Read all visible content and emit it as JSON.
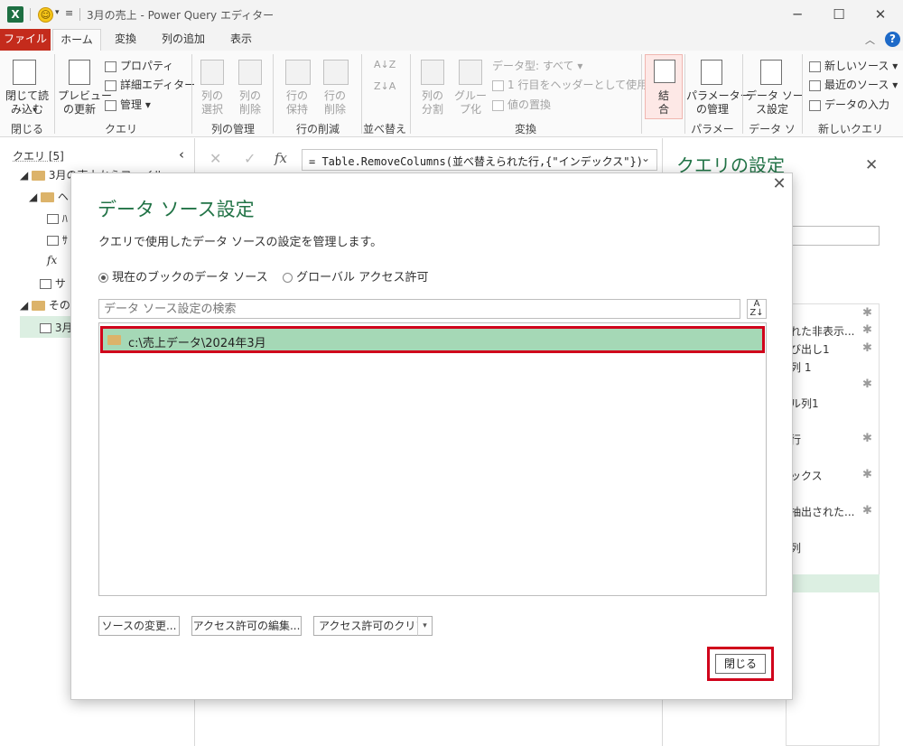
{
  "titlebar": {
    "title": "3月の売上 - Power Query エディター",
    "minimize": "─",
    "maximize": "☐",
    "close": "✕"
  },
  "tabs": [
    {
      "label": "ファイル"
    },
    {
      "label": "ホーム"
    },
    {
      "label": "変換"
    },
    {
      "label": "列の追加"
    },
    {
      "label": "表示"
    }
  ],
  "ribbon": {
    "close_load": "閉じて読\nみ込む",
    "close_group": "閉じる",
    "preview_refresh": "プレビュー\nの更新",
    "properties": "プロパティ",
    "advanced_editor": "詳細エディター",
    "manage": "管理",
    "query_group": "クエリ",
    "choose_columns": "列の\n選択",
    "remove_columns": "列の\n削除",
    "columns_group": "列の管理",
    "keep_rows": "行の\n保持",
    "remove_rows": "行の\n削除",
    "rows_group": "行の削減",
    "sort_group": "並べ替え",
    "split_column": "列の\n分割",
    "group_by": "グルー\nプ化",
    "data_type": "データ型: すべて",
    "use_first_row": "1 行目をヘッダーとして使用",
    "replace_values": "値の置換",
    "transform_group": "変換",
    "combine": "結\n合",
    "manage_params": "パラメーター\nの管理",
    "params_group": "パラメーター",
    "data_source_settings": "データ ソー\nス設定",
    "datasource_group": "データ ソース",
    "new_source": "新しいソース",
    "recent_sources": "最近のソース",
    "enter_data": "データの入力",
    "new_query_group": "新しいクエリ"
  },
  "left_pane": {
    "header": "クエリ [5]",
    "rows": [
      "3月の売上からファイル...",
      "ヘ",
      "ﾊ",
      "ｻ",
      "サ",
      "その",
      "3月"
    ]
  },
  "formula": {
    "text": "= Table.RemoveColumns(並べ替えられた行,{\"インデックス\"})"
  },
  "right_pane": {
    "title": "クエリの設定",
    "steps": [
      "れた非表示...",
      "び出し1",
      "列 1",
      "ル列1",
      "行",
      "ックス",
      "抽出された...",
      "列"
    ]
  },
  "dialog": {
    "title": "データ ソース設定",
    "subtitle": "クエリで使用したデータ ソースの設定を管理します。",
    "radio_current": "現在のブックのデータ ソース",
    "radio_global": "グローバル アクセス許可",
    "search_placeholder": "データ ソース設定の検索",
    "items": [
      {
        "label": "c:\\売上データ\\2024年3月",
        "selected": true
      }
    ],
    "btn_change_source": "ソースの変更...",
    "btn_edit_permissions": "アクセス許可の編集...",
    "btn_clear_permissions": "アクセス許可のクリア",
    "btn_close": "閉じる"
  },
  "colors": {
    "excel_green": "#217346",
    "file_tab": "#c42b1c",
    "selection": "#a5d8b6",
    "highlight_border": "#d0021b"
  }
}
